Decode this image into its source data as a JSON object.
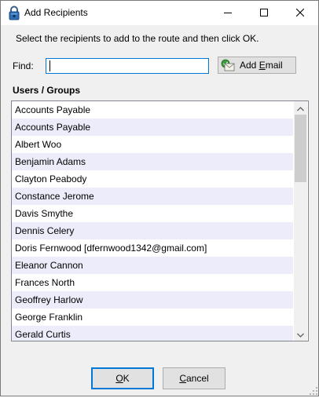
{
  "window": {
    "title": "Add Recipients",
    "controls": {
      "minimize": "minimize-icon",
      "maximize": "maximize-icon",
      "close": "close-icon"
    }
  },
  "instruction": "Select the recipients to add to the route and then click OK.",
  "find": {
    "label": "Find:",
    "value": "",
    "placeholder": ""
  },
  "add_email": {
    "label_prefix": "Add ",
    "label_underlined": "E",
    "label_suffix": "mail",
    "icon": "envelope-icon"
  },
  "users_groups": {
    "label": "Users / Groups",
    "items": [
      "Accounts Payable",
      "Accounts Payable",
      "Albert Woo",
      "Benjamin Adams",
      "Clayton Peabody",
      "Constance Jerome",
      "Davis Smythe",
      "Dennis Celery",
      "Doris Fernwood [dfernwood1342@gmail.com]",
      "Eleanor Cannon",
      "Frances North",
      "Geoffrey Harlow",
      "George Franklin",
      "Gerald Curtis"
    ]
  },
  "buttons": {
    "ok": {
      "underlined": "O",
      "rest": "K"
    },
    "cancel": {
      "underlined": "C",
      "rest": "ancel"
    }
  },
  "colors": {
    "accent": "#0078d7",
    "alt_row": "#ececfa",
    "window_bg": "#f0f0f0"
  }
}
